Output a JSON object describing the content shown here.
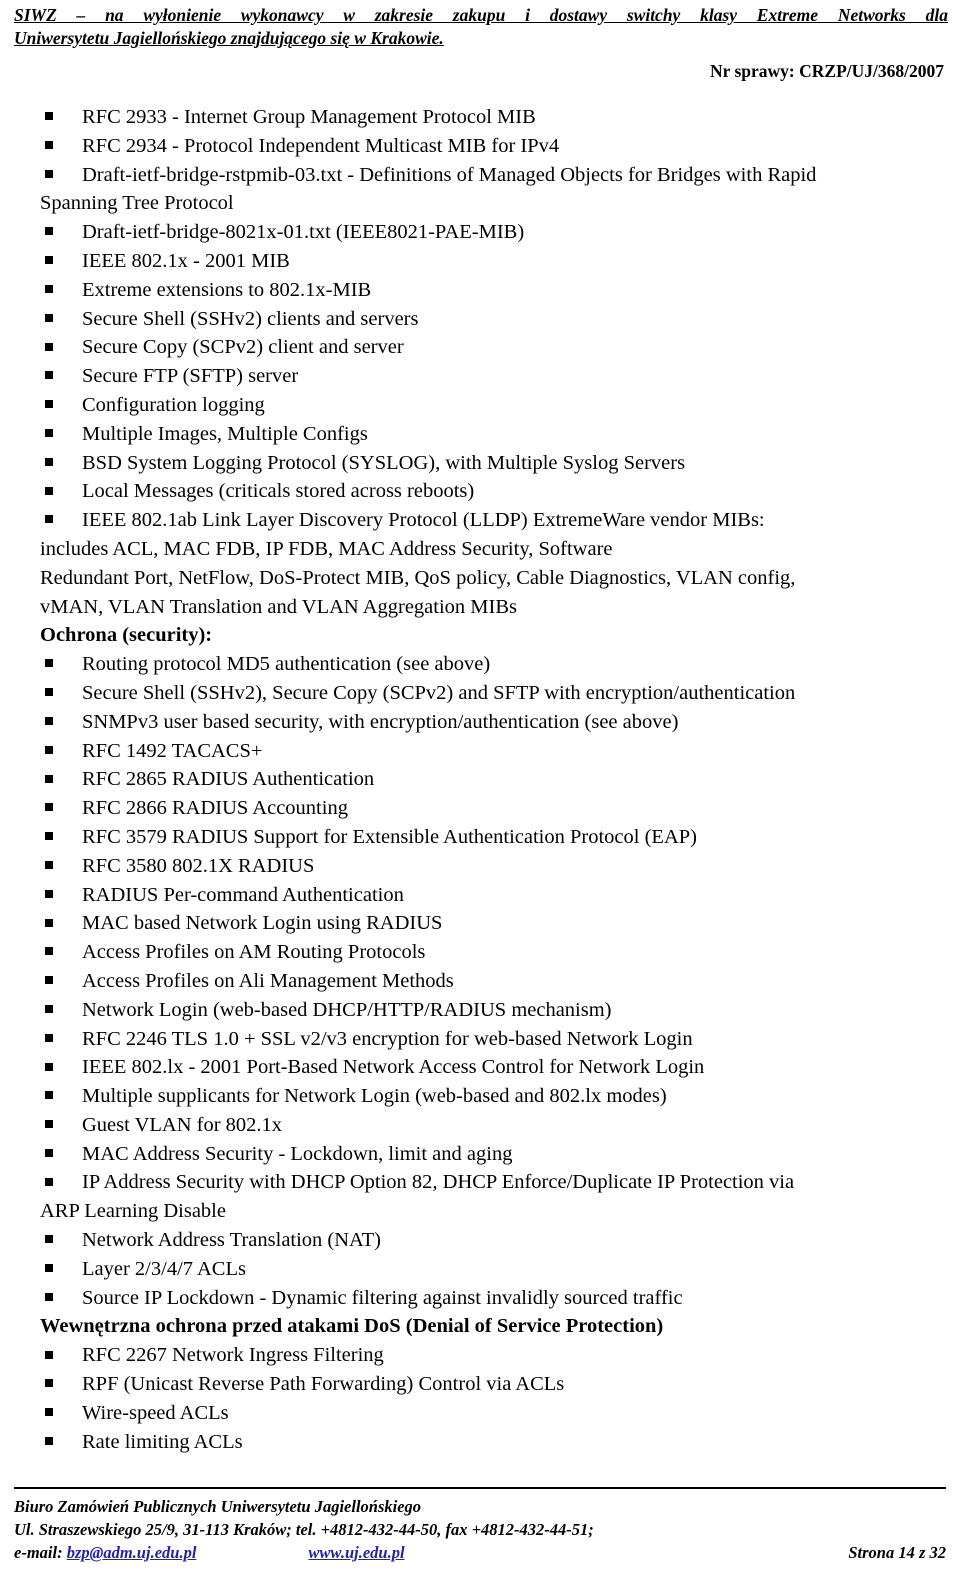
{
  "header": {
    "title_line1": "SIWZ – na wyłonienie wykonawcy w zakresie zakupu i dostawy switchy klasy Extreme Networks dla",
    "title_line2": "Uniwersytetu Jagiellońskiego znajdującego się w Krakowie.",
    "case_number": "Nr sprawy: CRZP/UJ/368/2007"
  },
  "bullet_glyph": "▪",
  "content": [
    {
      "kind": "bullet",
      "text": "RFC 2933 - Internet Group Management Protocol MIB"
    },
    {
      "kind": "bullet",
      "text": "RFC 2934 - Protocol Independent Multicast MIB for IPv4"
    },
    {
      "kind": "bullet-just",
      "text": "Draft-ietf-bridge-rstpmib-03.txt - Definitions of Managed Objects for Bridges with Rapid",
      "cont": "Spanning Tree Protocol"
    },
    {
      "kind": "bullet",
      "text": "Draft-ietf-bridge-8021x-01.txt (IEEE8021-PAE-MIB)"
    },
    {
      "kind": "bullet",
      "text": "IEEE 802.1x - 2001 MIB"
    },
    {
      "kind": "bullet",
      "text": "Extreme extensions to 802.1x-MIB"
    },
    {
      "kind": "bullet",
      "text": "Secure Shell (SSHv2) clients and servers"
    },
    {
      "kind": "bullet",
      "text": "Secure Copy (SCPv2) client and server"
    },
    {
      "kind": "bullet",
      "text": "Secure FTP (SFTP) server"
    },
    {
      "kind": "bullet",
      "text": "Configuration logging"
    },
    {
      "kind": "bullet",
      "text": "Multiple Images, Multiple Configs"
    },
    {
      "kind": "bullet",
      "text": "BSD System Logging Protocol (SYSLOG), with Multiple Syslog Servers"
    },
    {
      "kind": "bullet",
      "text": "Local Messages (criticals stored across reboots)"
    },
    {
      "kind": "bullet-just",
      "text": "IEEE 802.1ab Link Layer Discovery Protocol (LLDP) ExtremeWare vendor MIBs:",
      "cont": "includes ACL, MAC FDB, IP FDB, MAC Address Security, Software",
      "cont2": "Redundant Port, NetFlow, DoS-Protect MIB, QoS policy, Cable Diagnostics, VLAN config,",
      "cont3": "vMAN, VLAN Translation and VLAN Aggregation MIBs"
    },
    {
      "kind": "heading",
      "text": "Ochrona (security):"
    },
    {
      "kind": "bullet",
      "text": "Routing protocol MD5 authentication (see above)"
    },
    {
      "kind": "bullet",
      "text": "Secure Shell (SSHv2), Secure Copy (SCPv2) and SFTP with encryption/authentication"
    },
    {
      "kind": "bullet",
      "text": "SNMPv3 user based security, with encryption/authentication (see above)"
    },
    {
      "kind": "bullet",
      "text": "RFC 1492 TACACS+"
    },
    {
      "kind": "bullet",
      "text": "RFC 2865 RADIUS Authentication"
    },
    {
      "kind": "bullet",
      "text": "RFC 2866 RADIUS Accounting"
    },
    {
      "kind": "bullet",
      "text": "RFC 3579 RADIUS Support for Extensible Authentication Protocol (EAP)"
    },
    {
      "kind": "bullet",
      "text": "RFC 3580 802.1X RADIUS"
    },
    {
      "kind": "bullet",
      "text": "RADIUS Per-command Authentication"
    },
    {
      "kind": "bullet",
      "text": "MAC based Network Login using RADIUS"
    },
    {
      "kind": "bullet",
      "text": "Access Profiles on AM Routing Protocols"
    },
    {
      "kind": "bullet",
      "text": "Access Profiles on Ali Management Methods"
    },
    {
      "kind": "bullet",
      "text": "Network Login (web-based DHCP/HTTP/RADIUS mechanism)"
    },
    {
      "kind": "bullet",
      "text": "RFC 2246 TLS 1.0 + SSL v2/v3 encryption for web-based Network Login"
    },
    {
      "kind": "bullet",
      "text": "IEEE 802.lx - 2001 Port-Based Network Access Control for Network Login"
    },
    {
      "kind": "bullet",
      "text": "Multiple supplicants for Network Login (web-based and 802.lx modes)"
    },
    {
      "kind": "bullet",
      "text": "Guest VLAN for 802.1x"
    },
    {
      "kind": "bullet",
      "text": "MAC Address Security - Lockdown, limit and aging"
    },
    {
      "kind": "bullet-just",
      "text": "IP Address Security with DHCP Option 82, DHCP Enforce/Duplicate IP Protection via",
      "cont": "ARP Learning Disable"
    },
    {
      "kind": "bullet",
      "text": "Network Address Translation (NAT)"
    },
    {
      "kind": "bullet",
      "text": "Layer 2/3/4/7 ACLs"
    },
    {
      "kind": "bullet",
      "text": "Source IP Lockdown - Dynamic filtering against invalidly sourced traffic"
    },
    {
      "kind": "heading",
      "text": "Wewnętrzna ochrona przed atakami DoS (Denial of Service Protection)"
    },
    {
      "kind": "bullet",
      "text": "RFC 2267 Network Ingress Filtering"
    },
    {
      "kind": "bullet",
      "text": "RPF (Unicast Reverse Path Forwarding) Control via ACLs"
    },
    {
      "kind": "bullet",
      "text": "Wire-speed ACLs"
    },
    {
      "kind": "bullet",
      "text": "Rate limiting ACLs"
    }
  ],
  "footer": {
    "org": "Biuro Zamówień Publicznych Uniwersytetu Jagiellońskiego",
    "address": "Ul. Straszewskiego 25/9, 31-113 Kraków; tel. +4812-432-44-50, fax +4812-432-44-51;",
    "email_label": "e-mail:",
    "email": "bzp@adm.uj.edu.pl",
    "website": "www.uj.edu.pl",
    "page": "Strona 14 z 32",
    "link_color": "#2121b0"
  }
}
